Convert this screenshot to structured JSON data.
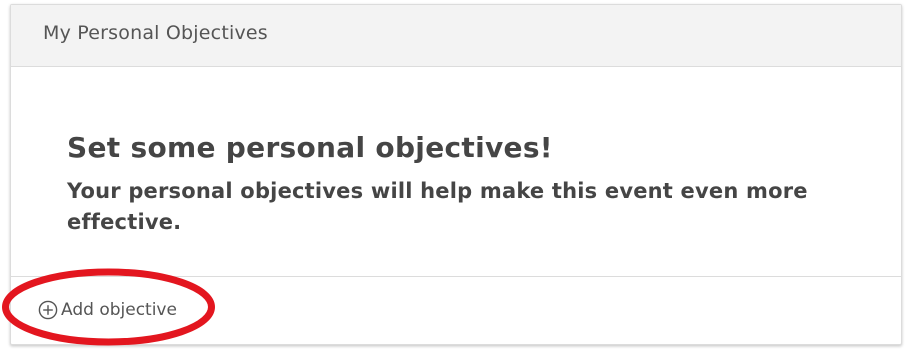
{
  "card": {
    "header_title": "My Personal Objectives",
    "empty_state": {
      "title": "Set some personal objectives!",
      "subtitle": "Your personal objectives will help make this event even more effective."
    },
    "footer": {
      "add_button_label": "Add objective",
      "add_button_icon": "plus-circle-icon"
    }
  },
  "annotation": {
    "type": "highlight-ellipse",
    "color": "#e3161f"
  }
}
